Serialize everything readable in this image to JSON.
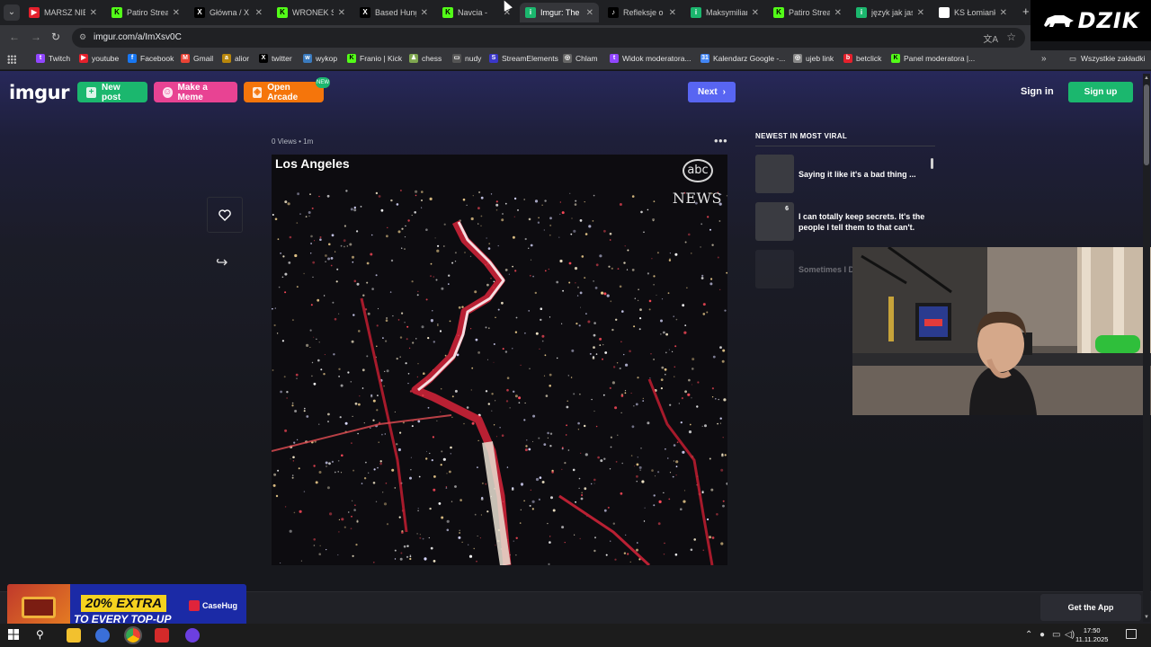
{
  "browser": {
    "tabs": [
      {
        "title": "MARSZ NIEP",
        "fav_color": "#e5202c",
        "fav_glyph": "▶",
        "active": false
      },
      {
        "title": "Patiro Strea",
        "fav_color": "#53fc18",
        "fav_glyph": "K",
        "active": false
      },
      {
        "title": "Główna / X",
        "fav_color": "#000000",
        "fav_glyph": "X",
        "active": false
      },
      {
        "title": "WRONEK St",
        "fav_color": "#53fc18",
        "fav_glyph": "K",
        "active": false
      },
      {
        "title": "Based Hung",
        "fav_color": "#000000",
        "fav_glyph": "X",
        "active": false
      },
      {
        "title": "Navcia -",
        "fav_color": "#53fc18",
        "fav_glyph": "K",
        "active": false
      },
      {
        "title": "Imgur: The",
        "fav_color": "#1bb76e",
        "fav_glyph": "i",
        "active": true
      },
      {
        "title": "Refleksje o",
        "fav_color": "#000000",
        "fav_glyph": "♪",
        "active": false
      },
      {
        "title": "Maksymilian",
        "fav_color": "#1bb76e",
        "fav_glyph": "i",
        "active": false
      },
      {
        "title": "Patiro Strea",
        "fav_color": "#53fc18",
        "fav_glyph": "K",
        "active": false
      },
      {
        "title": "język jak jas",
        "fav_color": "#1bb76e",
        "fav_glyph": "i",
        "active": false
      },
      {
        "title": "KS Łomianki",
        "fav_color": "#ffffff",
        "fav_glyph": "",
        "active": false
      }
    ],
    "url": "imgur.com/a/ImXsv0C",
    "bookmarks": [
      {
        "label": "Twitch",
        "color": "#9146ff",
        "glyph": "t"
      },
      {
        "label": "youtube",
        "color": "#e5202c",
        "glyph": "▶"
      },
      {
        "label": "Facebook",
        "color": "#1877f2",
        "glyph": "f"
      },
      {
        "label": "Gmail",
        "color": "#ea4335",
        "glyph": "M"
      },
      {
        "label": "alior",
        "color": "#b8860b",
        "glyph": "a"
      },
      {
        "label": "twitter",
        "color": "#000000",
        "glyph": "X"
      },
      {
        "label": "wykop",
        "color": "#3b7bbf",
        "glyph": "w"
      },
      {
        "label": "Franio | Kick",
        "color": "#53fc18",
        "glyph": "K"
      },
      {
        "label": "chess",
        "color": "#7fa650",
        "glyph": "♟"
      },
      {
        "label": "nudy",
        "color": "#555555",
        "glyph": "▭"
      },
      {
        "label": "StreamElements",
        "color": "#3b37c9",
        "glyph": "S"
      },
      {
        "label": "Chlam",
        "color": "#666666",
        "glyph": "◎"
      },
      {
        "label": "Widok moderatora...",
        "color": "#9146ff",
        "glyph": "t"
      },
      {
        "label": "Kalendarz Google -...",
        "color": "#4285f4",
        "glyph": "31"
      },
      {
        "label": "ujeb link",
        "color": "#888888",
        "glyph": "◎"
      },
      {
        "label": "betclick",
        "color": "#e5202c",
        "glyph": "b"
      },
      {
        "label": "Panel moderatora |...",
        "color": "#53fc18",
        "glyph": "K"
      }
    ],
    "all_bookmarks": "Wszystkie zakładki"
  },
  "overlay": {
    "brand": "DZIK"
  },
  "imgur": {
    "logo": "imgur",
    "new_post": "New post",
    "make_meme": "Make a Meme",
    "open_arcade": "Open Arcade",
    "arcade_badge": "NEW",
    "next": "Next",
    "sign_in": "Sign in",
    "sign_up": "Sign up",
    "post_meta": "0 Views • 1m",
    "video": {
      "location": "Los Angeles",
      "network": "abc",
      "network_sub": "NEWS"
    },
    "sidebar": {
      "title": "NEWEST IN MOST VIRAL",
      "items": [
        {
          "text": "Saying it like it's a bad thing ...",
          "badge": ""
        },
        {
          "text": "I can totally keep secrets. It's the people I tell them to that can't.",
          "badge": "6"
        },
        {
          "text": "Sometimes I D",
          "badge": ""
        }
      ]
    },
    "get_app": "Get the App"
  },
  "promo": {
    "headline": "20% EXTRA",
    "subline": "TO EVERY TOP-UP",
    "brand": "CaseHug"
  },
  "taskbar": {
    "time": "17:50",
    "date": "11.11.2025"
  },
  "colors": {
    "imgur_green": "#1bb76e",
    "meme_pink": "#e84393",
    "arcade_orange": "#f5750b",
    "next_blue": "#5865f2"
  }
}
